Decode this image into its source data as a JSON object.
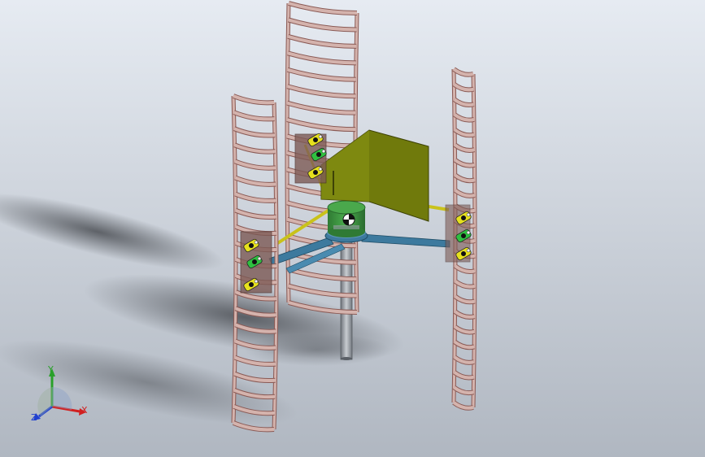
{
  "triad": {
    "x_label": "X",
    "y_label": "Y",
    "z_label": "Z"
  },
  "colors": {
    "background_top": "#e3e8ef",
    "background_bottom": "#aeb5bf",
    "blade_fill": "#d4b3ad",
    "blade_edge": "#8a5a55",
    "vane": "#707a0c",
    "vane_edge": "#3d4206",
    "hub": "#3b8f3e",
    "hub_cap": "#4aa84c",
    "arm": "#3d7a9e",
    "strut": "#c9c21a",
    "tower": "#9a9fa6",
    "sensor": "#e6e01e",
    "axis_x": "#d12020",
    "axis_y": "#2aa02a",
    "axis_z": "#2040d0"
  }
}
